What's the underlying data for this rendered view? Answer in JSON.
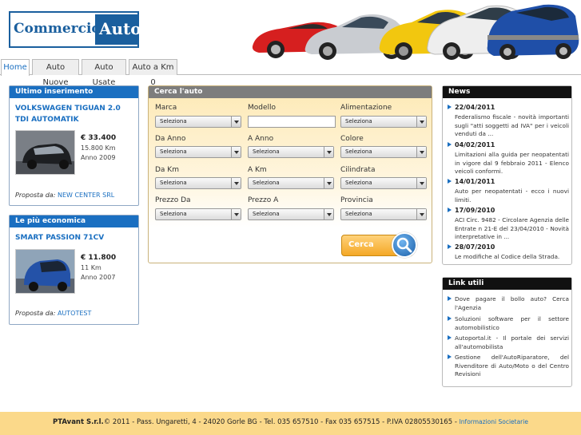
{
  "logo": {
    "word1": "Commercio",
    "word2": "Auto"
  },
  "tabs": [
    {
      "label": "Home"
    },
    {
      "label": "Auto Nuove"
    },
    {
      "label": "Auto Usate"
    },
    {
      "label": "Auto a Km 0"
    }
  ],
  "latest": {
    "heading": "Ultimo inserimento",
    "title": "VOLKSWAGEN TIGUAN 2.0 TDI AUTOMATIK",
    "price": "€ 33.400",
    "km": "15.800 Km",
    "year": "Anno 2009",
    "proposed_label": "Proposta da:",
    "dealer": "NEW CENTER SRL"
  },
  "cheapest": {
    "heading": "Le più economica",
    "title": "SMART PASSION 71CV",
    "price": "€ 11.800",
    "km": "11 Km",
    "year": "Anno 2007",
    "proposed_label": "Proposta da:",
    "dealer": "AUTOTEST"
  },
  "search": {
    "heading": "Cerca l'auto",
    "labels": {
      "marca": "Marca",
      "modello": "Modello",
      "alimentazione": "Alimentazione",
      "da_anno": "Da Anno",
      "a_anno": "A Anno",
      "colore": "Colore",
      "da_km": "Da Km",
      "a_km": "A Km",
      "cilindrata": "Cilindrata",
      "prezzo_da": "Prezzo Da",
      "prezzo_a": "Prezzo A",
      "provincia": "Provincia"
    },
    "select_value": "Seleziona",
    "modello_value": "",
    "button": "Cerca"
  },
  "news": {
    "heading": "News",
    "items": [
      {
        "date": "22/04/2011",
        "text": "Federalismo fiscale - novità importanti sugli \"atti soggetti ad IVA\" per i veicoli venduti da ..."
      },
      {
        "date": "04/02/2011",
        "text": "Limitazioni alla guida per neopatentati in vigore dal 9 febbraio 2011 - Elenco veicoli conformi."
      },
      {
        "date": "14/01/2011",
        "text": "Auto per neopatentati - ecco i nuovi limiti."
      },
      {
        "date": "17/09/2010",
        "text": "ACI Circ. 9482 - Circolare Agenzia delle Entrate n 21-E del 23/04/2010 - Novità interpretative in ..."
      },
      {
        "date": "28/07/2010",
        "text": "Le modifiche al Codice della Strada."
      }
    ]
  },
  "links": {
    "heading": "Link utili",
    "items": [
      "Dove pagare il bollo auto? Cerca l'Agenzia",
      "Soluzioni software per il settore automobilistico",
      "Autoportal.it - Il portale dei servizi all'automobilista",
      "Gestione dell'AutoRiparatore, del Rivenditore di Auto/Moto o del Centro Revisioni"
    ]
  },
  "footer": {
    "company": "PTAvant S.r.l.",
    "text": "© 2011 - Pass. Ungaretti, 4 - 24020 Gorle BG - Tel. 035 657510 - Fax 035 657515 - P.IVA 02805530165 - ",
    "link": "Informazioni Societarie"
  }
}
